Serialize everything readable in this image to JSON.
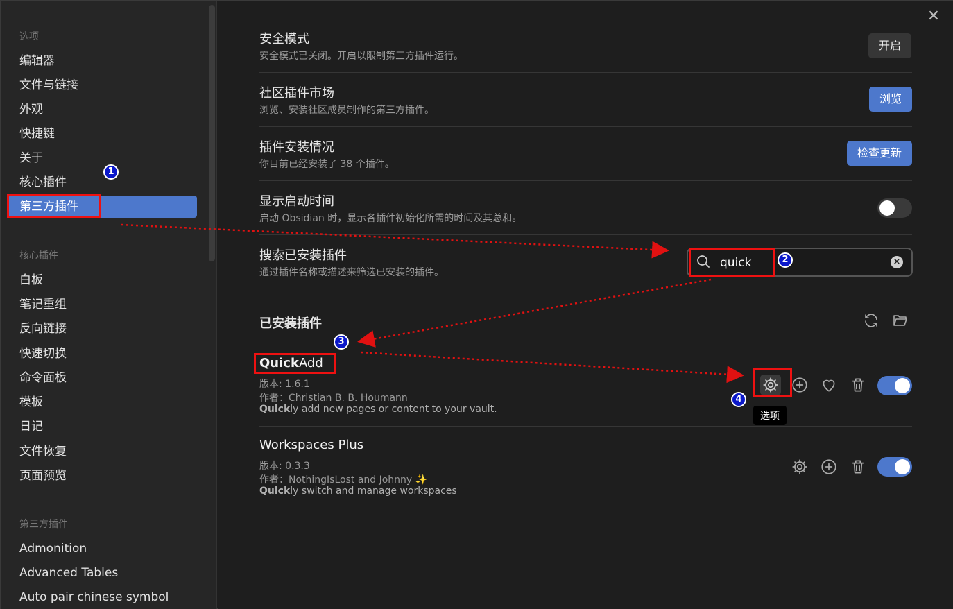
{
  "window": {
    "close_glyph": "✕"
  },
  "sidebar": {
    "section_options": "选项",
    "options": [
      "编辑器",
      "文件与链接",
      "外观",
      "快捷键",
      "关于",
      "核心插件",
      "第三方插件"
    ],
    "section_core": "核心插件",
    "core": [
      "白板",
      "笔记重组",
      "反向链接",
      "快速切换",
      "命令面板",
      "模板",
      "日记",
      "文件恢复",
      "页面预览"
    ],
    "section_community": "第三方插件",
    "community": [
      "Admonition",
      "Advanced Tables",
      "Auto pair chinese symbol"
    ]
  },
  "settings": {
    "safe_mode": {
      "name": "安全模式",
      "desc": "安全模式已关闭。开启以限制第三方插件运行。",
      "button": "开启"
    },
    "market": {
      "name": "社区插件市场",
      "desc": "浏览、安装社区成员制作的第三方插件。",
      "button": "浏览"
    },
    "install": {
      "name": "插件安装情况",
      "desc": "你目前已经安装了 38 个插件。",
      "button": "检查更新"
    },
    "startup": {
      "name": "显示启动时间",
      "desc": "启动 Obsidian 时，显示各插件初始化所需的时间及其总和。",
      "enabled": false
    },
    "search": {
      "name": "搜索已安装插件",
      "desc": "通过插件名称或描述来筛选已安装的插件。",
      "value": "quick"
    }
  },
  "installed": {
    "title": "已安装插件",
    "plugins": [
      {
        "name_hl": "Quick",
        "name_rest": "Add",
        "version": "版本: 1.6.1",
        "author": "作者：Christian B. B. Houmann",
        "desc_hl": "Quick",
        "desc_rest": "ly add new pages or content to your vault.",
        "enabled": true,
        "tooltip": "选项"
      },
      {
        "name": "Workspaces Plus",
        "version": "版本: 0.3.3",
        "author": "作者：NothingIsLost and Johnny ✨",
        "desc_hl": "Quick",
        "desc_rest": "ly switch and manage workspaces",
        "enabled": true
      }
    ]
  },
  "annotations": {
    "n1": "1",
    "n2": "2",
    "n3": "3",
    "n4": "4",
    "color": "#e11111"
  }
}
